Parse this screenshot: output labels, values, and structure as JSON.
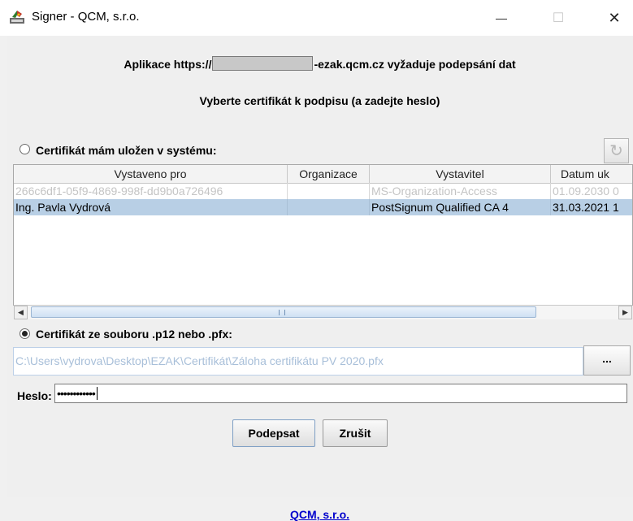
{
  "window": {
    "title": "Signer - QCM, s.r.o.",
    "minimize_glyph": "—",
    "maximize_glyph": "☐",
    "close_glyph": "✕"
  },
  "header": {
    "app_prefix": "Aplikace https://",
    "app_suffix": "-ezak.qcm.cz vyžaduje podepsání dat",
    "instruction": "Vyberte certifikát k podpisu (a zadejte heslo)"
  },
  "system_cert": {
    "label": "Certifikát mám uložen v systému:",
    "selected": false,
    "refresh_icon": "↻"
  },
  "table": {
    "columns": [
      "Vystaveno pro",
      "Organizace",
      "Vystavitel",
      "Datum uk"
    ],
    "rows": [
      {
        "subject": "266c6df1-05f9-4869-998f-dd9b0a726496",
        "organization": "",
        "issuer": "MS-Organization-Access",
        "date": "01.09.2030 0",
        "state": "disabled"
      },
      {
        "subject": "Ing. Pavla Vydrová",
        "organization": "",
        "issuer": "PostSignum Qualified CA 4",
        "date": "31.03.2021 1",
        "state": "selected"
      }
    ],
    "scroll_left_icon": "◀",
    "scroll_right_icon": "▶"
  },
  "file_cert": {
    "label": "Certifikát ze souboru .p12 nebo .pfx:",
    "selected": true,
    "path": "C:\\Users\\vydrova\\Desktop\\EZAK\\Certifikát\\Záloha certifikátu PV 2020.pfx",
    "browse_label": "..."
  },
  "password": {
    "label": "Heslo:",
    "value": "••••••••••••"
  },
  "buttons": {
    "sign": "Podepsat",
    "cancel": "Zrušit"
  },
  "footer": {
    "link": "QCM, s.r.o."
  }
}
